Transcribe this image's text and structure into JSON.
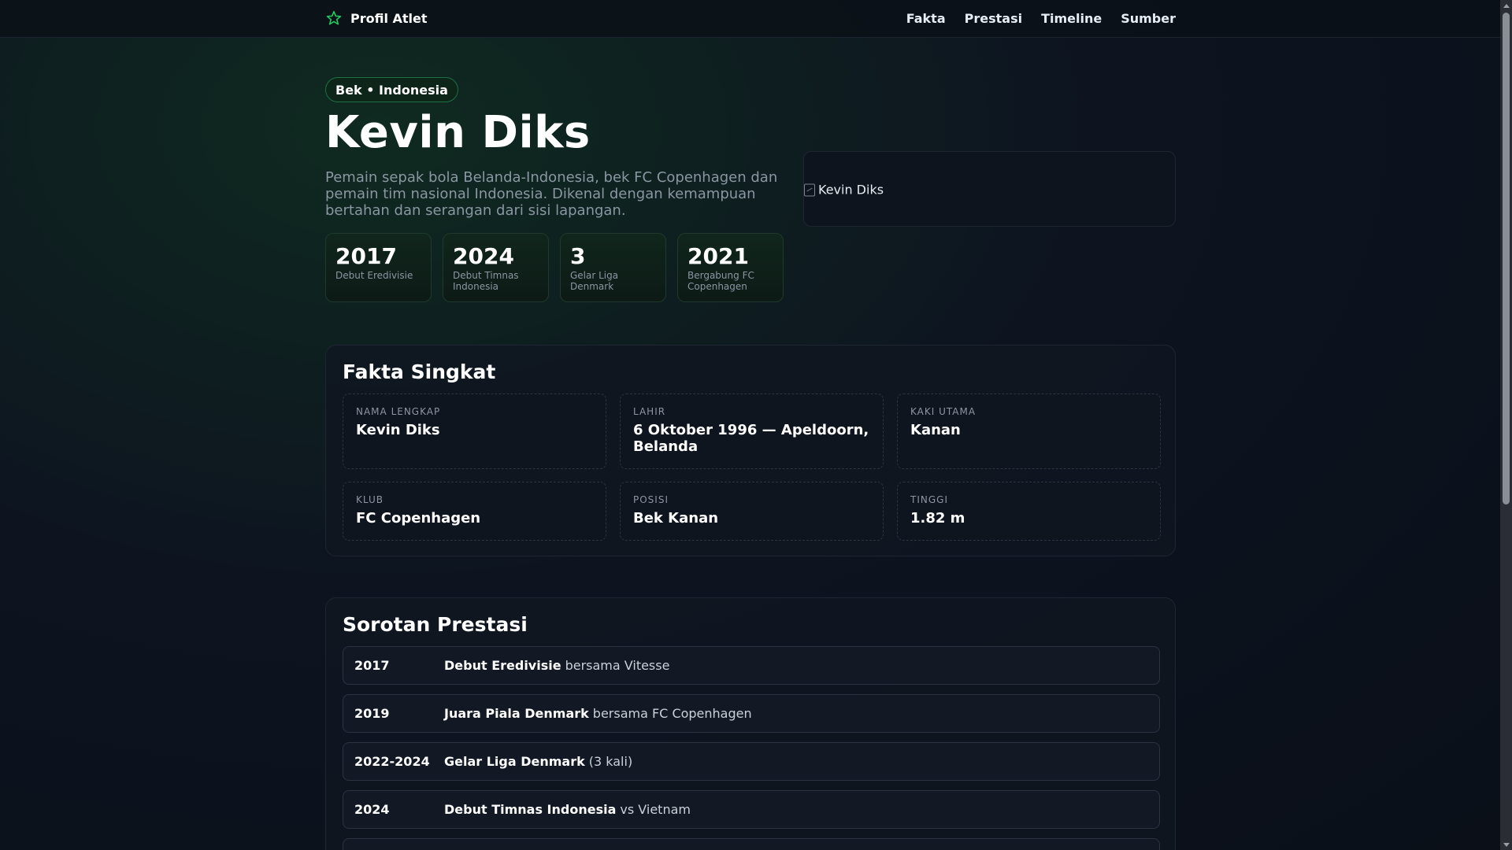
{
  "nav": {
    "brand": "Profil Atlet",
    "links": [
      "Fakta",
      "Prestasi",
      "Timeline",
      "Sumber"
    ]
  },
  "hero": {
    "tag": "Bek • Indonesia",
    "name": "Kevin Diks",
    "description": "Pemain sepak bola Belanda-Indonesia, bek FC Copenhagen dan pemain tim nasional Indonesia. Dikenal dengan kemampuan bertahan dan serangan dari sisi lapangan.",
    "photo_alt": "Kevin Diks",
    "stats": [
      {
        "value": "2017",
        "label": "Debut Eredivisie"
      },
      {
        "value": "2024",
        "label": "Debut Timnas Indonesia"
      },
      {
        "value": "3",
        "label": "Gelar Liga Denmark"
      },
      {
        "value": "2021",
        "label": "Bergabung FC Copenhagen"
      }
    ]
  },
  "facts": {
    "title": "Fakta Singkat",
    "items": [
      {
        "label": "NAMA LENGKAP",
        "value": "Kevin Diks"
      },
      {
        "label": "LAHIR",
        "value": "6 Oktober 1996 — Apeldoorn, Belanda"
      },
      {
        "label": "KAKI UTAMA",
        "value": "Kanan"
      },
      {
        "label": "KLUB",
        "value": "FC Copenhagen"
      },
      {
        "label": "POSISI",
        "value": "Bek Kanan"
      },
      {
        "label": "TINGGI",
        "value": "1.82 m"
      }
    ]
  },
  "achievements": {
    "title": "Sorotan Prestasi",
    "items": [
      {
        "year": "2017",
        "title": "Debut Eredivisie",
        "rest": "bersama Vitesse"
      },
      {
        "year": "2019",
        "title": "Juara Piala Denmark",
        "rest": "bersama FC Copenhagen"
      },
      {
        "year": "2022-2024",
        "title": "Gelar Liga Denmark",
        "rest": "(3 kali)"
      },
      {
        "year": "2024",
        "title": "Debut Timnas Indonesia",
        "rest": "vs Vietnam"
      }
    ]
  },
  "colors": {
    "accent": "#22c55e",
    "background": "#0a0f18"
  }
}
